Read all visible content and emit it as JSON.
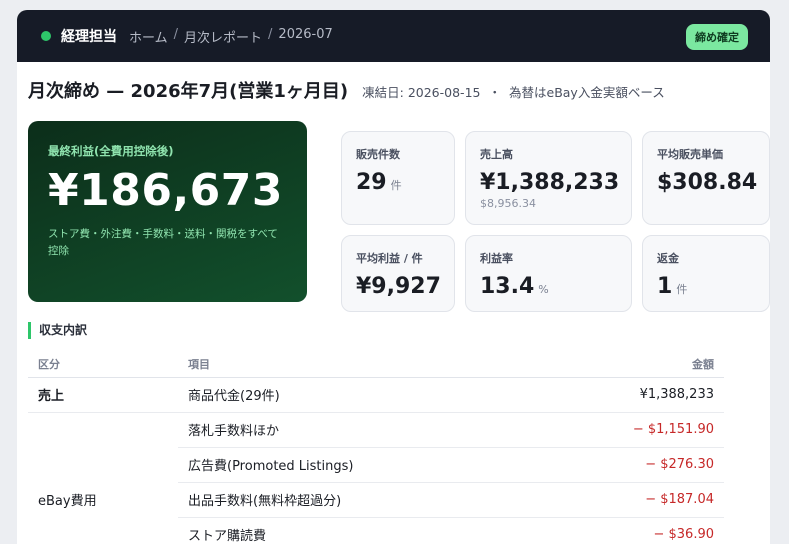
{
  "header": {
    "role": "経理担当",
    "breadcrumb": [
      "ホーム",
      "月次レポート",
      "2026-07"
    ],
    "status_badge": "締め確定"
  },
  "title": {
    "main": "月次締め — 2026年7月(営業1ヶ月目)",
    "frozen_date": "凍結日: 2026-08-15",
    "separator": "・",
    "fx_note": "為替はeBay入金実額ベース"
  },
  "hero": {
    "label": "最終利益(全費用控除後)",
    "value": "¥186,673",
    "note": "ストア費・外注費・手数料・送料・関税をすべて控除"
  },
  "stats": [
    {
      "label": "販売件数",
      "value": "29",
      "unit": "件",
      "sub": ""
    },
    {
      "label": "売上高",
      "value": "¥1,388,233",
      "unit": "",
      "sub": "$8,956.34"
    },
    {
      "label": "平均販売単価",
      "value": "$308.84",
      "unit": "",
      "sub": ""
    },
    {
      "label": "平均利益 / 件",
      "value": "¥9,927",
      "unit": "",
      "sub": ""
    },
    {
      "label": "利益率",
      "value": "13.4",
      "unit": "%",
      "sub": ""
    },
    {
      "label": "返金",
      "value": "1",
      "unit": "件",
      "sub": ""
    }
  ],
  "breakdown": {
    "section_title": "収支内訳",
    "columns": [
      "区分",
      "項目",
      "金額"
    ],
    "rows": [
      {
        "category": "売上",
        "item": "商品代金(29件)",
        "amount": "¥1,388,233"
      },
      {
        "category": "",
        "item": "落札手数料ほか",
        "amount": "− $1,151.90"
      },
      {
        "category": "",
        "item": "広告費(Promoted Listings)",
        "amount": "− $276.30"
      },
      {
        "category": "eBay費用",
        "item": "出品手数料(無料枠超過分)",
        "amount": "− $187.04"
      },
      {
        "category": "",
        "item": "ストア購読費",
        "amount": "− $36.90"
      }
    ]
  },
  "colors": {
    "accent": "#2ec66a",
    "negative": "#c62828",
    "topbar": "#161b27"
  }
}
